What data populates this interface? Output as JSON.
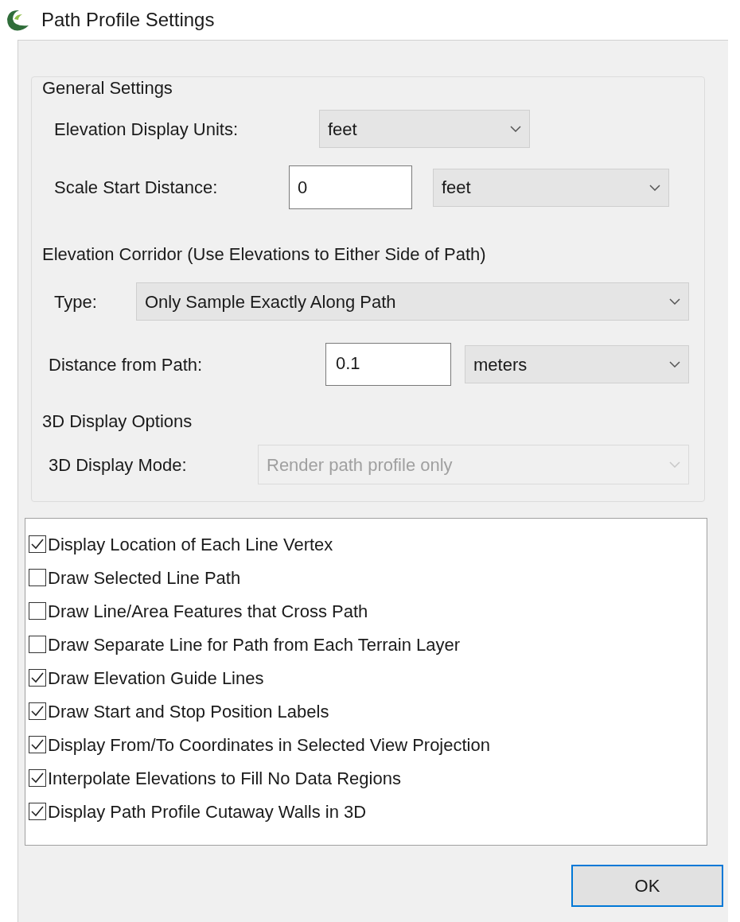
{
  "window": {
    "title": "Path Profile Settings"
  },
  "general_settings": {
    "heading": "General Settings",
    "elevation_display_units": {
      "label": "Elevation Display Units:",
      "value": "feet"
    },
    "scale_start_distance": {
      "label": "Scale Start Distance:",
      "value": "0",
      "unit": "feet"
    }
  },
  "elevation_corridor": {
    "heading": "Elevation Corridor (Use Elevations to Either Side of Path)",
    "type": {
      "label": "Type:",
      "value": "Only Sample Exactly Along Path"
    },
    "distance_from_path": {
      "label": "Distance from Path:",
      "value": "0.1",
      "unit": "meters"
    }
  },
  "display_3d": {
    "heading": "3D Display Options",
    "mode": {
      "label": "3D Display Mode:",
      "value": "Render path profile only",
      "disabled": true
    }
  },
  "options": [
    {
      "label": "Display Location of Each Line Vertex",
      "checked": true
    },
    {
      "label": "Draw Selected Line Path",
      "checked": false
    },
    {
      "label": "Draw Line/Area Features that Cross Path",
      "checked": false
    },
    {
      "label": "Draw Separate Line for Path from Each Terrain Layer",
      "checked": false
    },
    {
      "label": "Draw Elevation Guide Lines",
      "checked": true
    },
    {
      "label": "Draw Start and Stop Position Labels",
      "checked": true
    },
    {
      "label": "Display From/To Coordinates in Selected View Projection",
      "checked": true
    },
    {
      "label": "Interpolate Elevations to Fill No Data Regions",
      "checked": true
    },
    {
      "label": "Display Path Profile Cutaway Walls in 3D",
      "checked": true
    }
  ],
  "buttons": [
    "OK"
  ]
}
